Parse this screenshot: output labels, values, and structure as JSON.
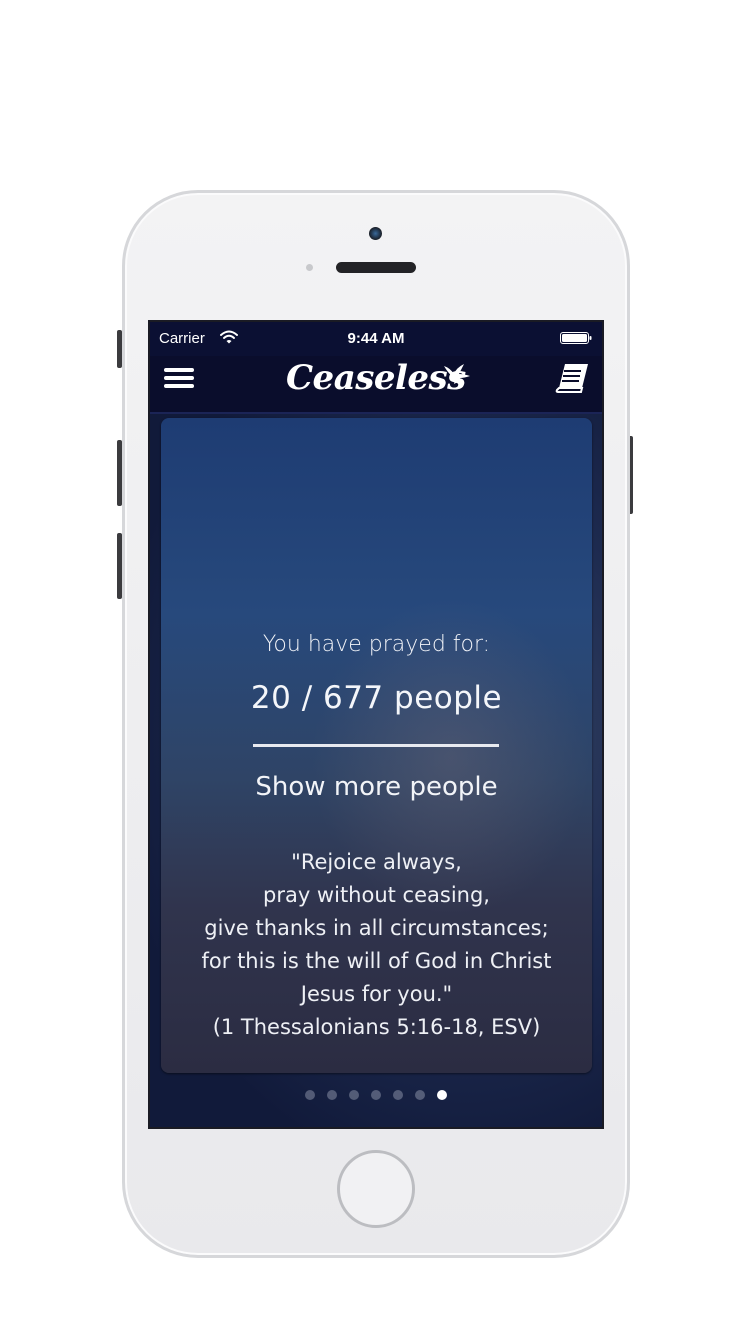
{
  "status_bar": {
    "carrier": "Carrier",
    "time": "9:44 AM"
  },
  "nav": {
    "app_name": "Ceaseless",
    "left_icon": "menu-icon",
    "right_icon": "book-icon"
  },
  "card": {
    "prayed_label": "You have prayed for:",
    "count_text": "20 / 677 people",
    "progress": {
      "done": 20,
      "total": 677
    },
    "show_more_label": "Show more people",
    "verse_lines": [
      "\"Rejoice always,",
      "pray without ceasing,",
      "give thanks in all circumstances;",
      "for this is the will of God in Christ",
      "Jesus for you.\"",
      "(1 Thessalonians 5:16-18, ESV)"
    ]
  },
  "pager": {
    "page_count": 7,
    "active_page": 7
  },
  "colors": {
    "nav_background": "#0a0d2c",
    "card_top": "#1e3c73",
    "card_bottom": "#2b2c42",
    "text": "#f0f2f7"
  }
}
